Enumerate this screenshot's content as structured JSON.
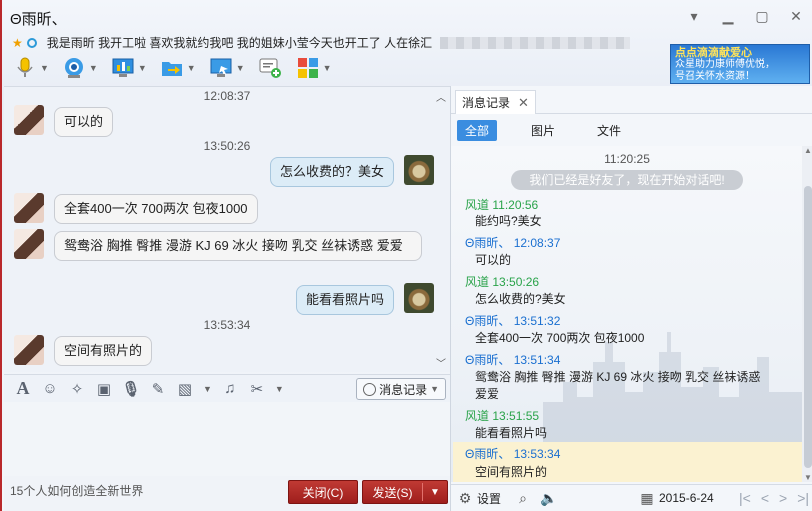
{
  "window": {
    "title": "Θ雨昕、",
    "controls": [
      "minimize",
      "maximize",
      "close"
    ]
  },
  "signature": {
    "text": "我是雨昕 我开工啦 喜欢我就约我吧 我的姐妹小莹今天也开工了 人在徐汇"
  },
  "toolbar": {
    "items": [
      {
        "name": "voice-call-icon"
      },
      {
        "name": "video-call-icon"
      },
      {
        "name": "remote-assist-icon"
      },
      {
        "name": "send-file-icon"
      },
      {
        "name": "screen-share-icon"
      },
      {
        "name": "group-chat-icon"
      },
      {
        "name": "apps-icon"
      }
    ]
  },
  "ad": {
    "line1": "点点滴滴献爱心",
    "line2": "众星助力康师傅优悦，",
    "line3": "号召关怀水资源！"
  },
  "chat": {
    "messages": [
      {
        "time": "12:08:37"
      },
      {
        "side": "left",
        "text": "可以的"
      },
      {
        "time": "13:50:26"
      },
      {
        "side": "right",
        "text": "怎么收费的？美女"
      },
      {
        "side": "left",
        "text": "全套400一次  700两次  包夜1000"
      },
      {
        "side": "left",
        "text": "鸳鸯浴  胸推    臀推    漫游  KJ    69    冰火  接吻    乳交    丝袜诱惑    爱爱"
      },
      {
        "side": "right",
        "text": "能看看照片吗"
      },
      {
        "time": "13:53:34"
      },
      {
        "side": "left",
        "text": "空间有照片的"
      }
    ]
  },
  "input_toolbar": {
    "icons": [
      "font-icon",
      "emoji-icon",
      "magic-icon",
      "video-clip-icon",
      "mic-icon",
      "edit-icon",
      "image-icon",
      "music-icon",
      "screenshot-icon"
    ],
    "message_record_label": "消息记录"
  },
  "bottom": {
    "tip": "15个人如何创造全新世界",
    "close_label": "关闭(C)",
    "send_label": "发送(S)"
  },
  "history_panel": {
    "tab_label": "消息记录",
    "filters": [
      "全部",
      "图片",
      "文件"
    ],
    "first_time": "11:20:25",
    "notice": "我们已经是好友了，现在开始对话吧!",
    "entries": [
      {
        "sender": "风道",
        "time": "11:20:56",
        "text": "能约吗?美女",
        "color": "green"
      },
      {
        "sender": "Θ雨昕、",
        "time": "12:08:37",
        "text": "可以的",
        "color": "blue"
      },
      {
        "sender": "风道",
        "time": "13:50:26",
        "text": "怎么收费的?美女",
        "color": "green"
      },
      {
        "sender": "Θ雨昕、",
        "time": "13:51:32",
        "text": "全套400一次 700两次 包夜1000",
        "color": "blue"
      },
      {
        "sender": "Θ雨昕、",
        "time": "13:51:34",
        "text": "鸳鸯浴 胸推 臀推 漫游 KJ 69 冰火 接吻 乳交 丝袜诱惑 爱爱",
        "color": "blue"
      },
      {
        "sender": "风道",
        "time": "13:51:55",
        "text": "能看看照片吗",
        "color": "green"
      },
      {
        "sender": "Θ雨昕、",
        "time": "13:53:34",
        "text": "空间有照片的",
        "color": "blue"
      }
    ],
    "settings_label": "设置",
    "date": "2015-6-24"
  },
  "colors": {
    "accent_red": "#b3282a",
    "filter_active": "#3a8de0",
    "green_sender": "#2aa34a",
    "blue_sender": "#1a6fd0"
  }
}
